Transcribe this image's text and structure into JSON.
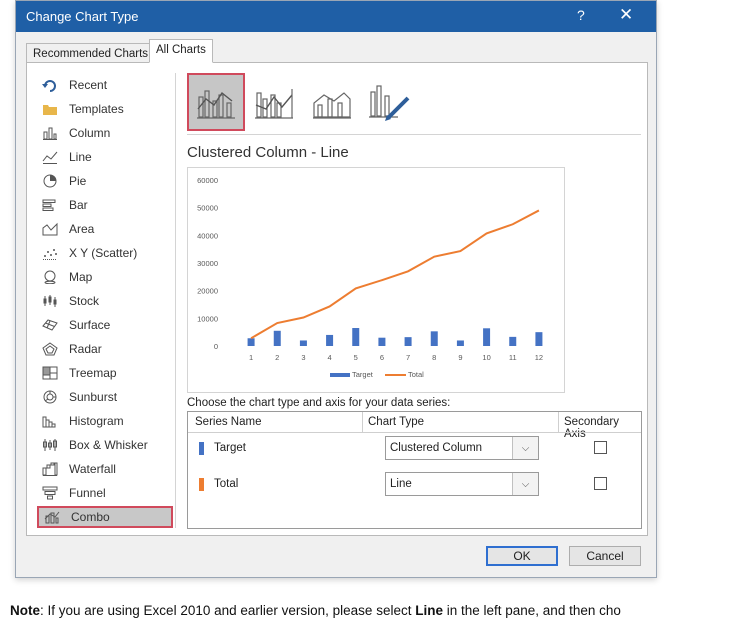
{
  "dialog": {
    "title": "Change Chart Type",
    "help_glyph": "?",
    "close_glyph": "✕"
  },
  "tabs": [
    {
      "label": "Recommended Charts"
    },
    {
      "label": "All Charts"
    }
  ],
  "sidebar": {
    "items": [
      {
        "label": "Recent",
        "icon": "recent-icon"
      },
      {
        "label": "Templates",
        "icon": "folder-icon"
      },
      {
        "label": "Column",
        "icon": "column-chart-icon"
      },
      {
        "label": "Line",
        "icon": "line-chart-icon"
      },
      {
        "label": "Pie",
        "icon": "pie-chart-icon"
      },
      {
        "label": "Bar",
        "icon": "bar-chart-icon"
      },
      {
        "label": "Area",
        "icon": "area-chart-icon"
      },
      {
        "label": "X Y (Scatter)",
        "icon": "scatter-chart-icon"
      },
      {
        "label": "Map",
        "icon": "map-chart-icon"
      },
      {
        "label": "Stock",
        "icon": "stock-chart-icon"
      },
      {
        "label": "Surface",
        "icon": "surface-chart-icon"
      },
      {
        "label": "Radar",
        "icon": "radar-chart-icon"
      },
      {
        "label": "Treemap",
        "icon": "treemap-chart-icon"
      },
      {
        "label": "Sunburst",
        "icon": "sunburst-chart-icon"
      },
      {
        "label": "Histogram",
        "icon": "histogram-chart-icon"
      },
      {
        "label": "Box & Whisker",
        "icon": "box-whisker-chart-icon"
      },
      {
        "label": "Waterfall",
        "icon": "waterfall-chart-icon"
      },
      {
        "label": "Funnel",
        "icon": "funnel-chart-icon"
      },
      {
        "label": "Combo",
        "icon": "combo-chart-icon"
      }
    ],
    "selected": "Combo"
  },
  "combo_variants": [
    {
      "icon": "clustered-column-line-icon",
      "selected": true
    },
    {
      "icon": "clustered-column-line-secondary-axis-icon",
      "selected": false
    },
    {
      "icon": "stacked-area-clustered-column-icon",
      "selected": false
    },
    {
      "icon": "custom-combination-icon",
      "selected": false
    }
  ],
  "subtitle": "Clustered Column - Line",
  "chart_data": {
    "type": "bar",
    "categories": [
      "1",
      "2",
      "3",
      "4",
      "5",
      "6",
      "7",
      "8",
      "9",
      "10",
      "11",
      "12"
    ],
    "y_ticks": [
      "0",
      "10000",
      "20000",
      "30000",
      "40000",
      "50000",
      "60000"
    ],
    "ylim": [
      0,
      60000
    ],
    "series": [
      {
        "name": "Target",
        "type": "bar",
        "color": "#4472c4",
        "values": [
          2800,
          5500,
          2000,
          4000,
          6500,
          3000,
          3200,
          5300,
          2000,
          6400,
          3300,
          5000
        ]
      },
      {
        "name": "Total",
        "type": "line",
        "color": "#ed7d31",
        "values": [
          2800,
          8300,
          10300,
          14300,
          20800,
          23800,
          27000,
          32300,
          34300,
          40700,
          44000,
          49000
        ]
      }
    ],
    "legend": "bottom",
    "grid": false
  },
  "series_panel": {
    "heading": "Choose the chart type and axis for your data series:",
    "col_name": "Series Name",
    "col_type": "Chart Type",
    "col_axis": "Secondary Axis",
    "rows": [
      {
        "name": "Target",
        "color": "#4472c4",
        "chart_type": "Clustered Column",
        "secondary": false
      },
      {
        "name": "Total",
        "color": "#ed7d31",
        "chart_type": "Line",
        "secondary": false
      }
    ]
  },
  "buttons": {
    "ok": "OK",
    "cancel": "Cancel"
  },
  "note": {
    "prefix": "Note",
    "text1": ": If you are using Excel 2010 and earlier version, please select ",
    "bold": "Line",
    "text2": " in the left pane, and then cho"
  }
}
